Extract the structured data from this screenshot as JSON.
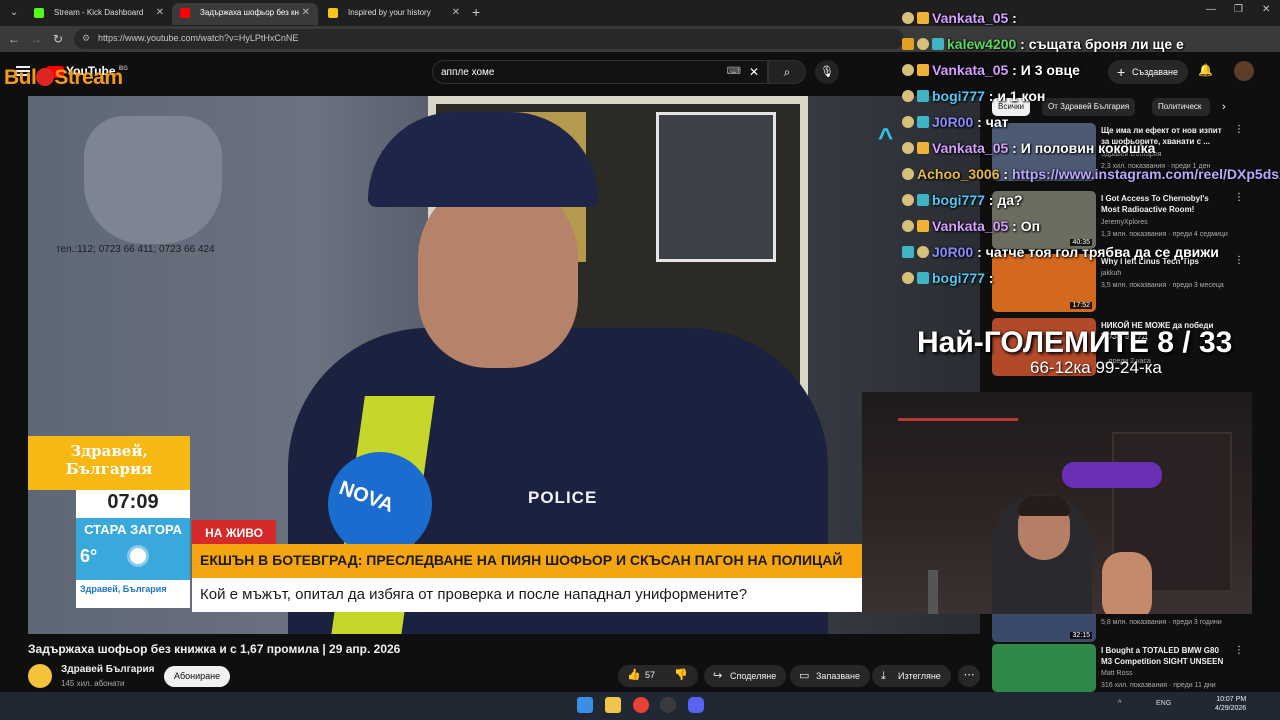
{
  "browser": {
    "tabs": [
      {
        "title": "Stream - Kick Dashboard",
        "favicon_color": "#53fc18"
      },
      {
        "title": "Задържаха шофьор без кн",
        "favicon_color": "#ff0000"
      },
      {
        "title": "Inspired by your history",
        "favicon_color": "#f5c518"
      }
    ],
    "url": "https://www.youtube.com/watch?v=HyLPtHxCnNE"
  },
  "youtube": {
    "logo": "YouTube",
    "logo_region": "BG",
    "search_query": "аппле хоме",
    "create_label": "Създаване",
    "video": {
      "title": "Задържаха шофьор без книжка и с 1,67 промила | 29 апр. 2026",
      "channel": "Здравей България",
      "subscribers": "145 хил. абонати",
      "subscribe_label": "Абониране",
      "likes": "57",
      "share_label": "Споделяне",
      "save_label": "Запазване",
      "download_label": "Изтегляне"
    },
    "overlay": {
      "show_title": "Здравей, България",
      "time": "07:09",
      "city": "СТАРА ЗАГОРА",
      "temperature": "6°",
      "footer_brand": "Здравей, България",
      "live_label": "НА ЖИВО",
      "headline": "ЕКШЪН В БОТЕВГРАД: ПРЕСЛЕДВАНЕ НА ПИЯН ШОФЬОР И СКЪСАН ПАГОН НА ПОЛИЦАЙ",
      "subheadline": "Кой е мъжът, опитал да избяга от проверка и после нападнал униформените?",
      "phone_sign": "тел.:112; 0723 66 411; 0723 66 424",
      "police_text": "POLICE",
      "mic_text": "NOVA"
    },
    "chips": [
      "Всички",
      "От Здравей България",
      "Политическ"
    ],
    "recommendations": [
      {
        "title": "Ще има ли ефект от нов изпит за шофьорите, хванати с ...",
        "channel": "Здравей България",
        "meta": "2,3 хил. показвания · преди 1 ден",
        "duration": "",
        "thumb_color": "#4d5a73"
      },
      {
        "title": "I Got Access To Chernobyl's Most Radioactive Room!",
        "channel": "JeremyXplores",
        "meta": "1,3 млн. показвания · преди 4 седмици",
        "duration": "40:35",
        "thumb_color": "#6c6c60"
      },
      {
        "title": "Why I left Linus Tech Tips",
        "channel": "jakkuh",
        "meta": "3,5 млн. показвания · преди 3 месеца",
        "duration": "17:52",
        "thumb_color": "#d2691e"
      },
      {
        "title": "НИКОЙ НЕ МОЖЕ да победи ТОЗИ е ЛУД",
        "channel": "",
        "meta": "... преди 2 часа",
        "duration": "",
        "thumb_color": "#b24a2a"
      },
      {
        "title": "",
        "channel": "",
        "meta": "5,8 млн. показвания · преди 3 години",
        "duration": "32:15",
        "thumb_color": "#3b4a6b"
      },
      {
        "title": "I Bought a TOTALED BMW G80 M3 Competition SIGHT UNSEEN",
        "channel": "Matt Ross",
        "meta": "316 хил. показвания · преди 11 дни",
        "duration": "",
        "thumb_color": "#2f8a4a"
      }
    ]
  },
  "stream_overlay": {
    "logo_left": "Bul",
    "logo_right": "Stream",
    "chat": [
      {
        "user": "Vankata_05",
        "message": "",
        "color": "#d4a0ff"
      },
      {
        "user": "kalew4200",
        "message": "същата броня ли ще е",
        "color": "#5fd65f"
      },
      {
        "user": "Vankata_05",
        "message": "И 3 овце",
        "color": "#d4a0ff"
      },
      {
        "user": "bogi777",
        "message": "и 1 кон",
        "color": "#55c7f0"
      },
      {
        "user": "J0R00",
        "message": "чат",
        "color": "#8a8aff"
      },
      {
        "user": "Vankata_05",
        "message": "И половин кокошка",
        "color": "#d4a0ff"
      },
      {
        "user": "Achoo_3006",
        "message": "https://www.instagram.com/reel/DXp5dsx",
        "color": "#e8b84a"
      },
      {
        "user": "bogi777",
        "message": "да?",
        "color": "#55c7f0"
      },
      {
        "user": "Vankata_05",
        "message": "Оп",
        "color": "#d4a0ff"
      },
      {
        "user": "J0R00",
        "message": "чатче тоя гол трябва да се движи",
        "color": "#8a8aff"
      },
      {
        "user": "bogi777",
        "message": "",
        "color": "#55c7f0"
      }
    ],
    "counter_title": "Най-ГОЛЕМИТЕ 8 / 33",
    "counter_sub": "66-12ка 99-24-ка"
  },
  "taskbar": {
    "language": "ENG",
    "time": "10:07 PM",
    "date": "4/29/2026"
  }
}
